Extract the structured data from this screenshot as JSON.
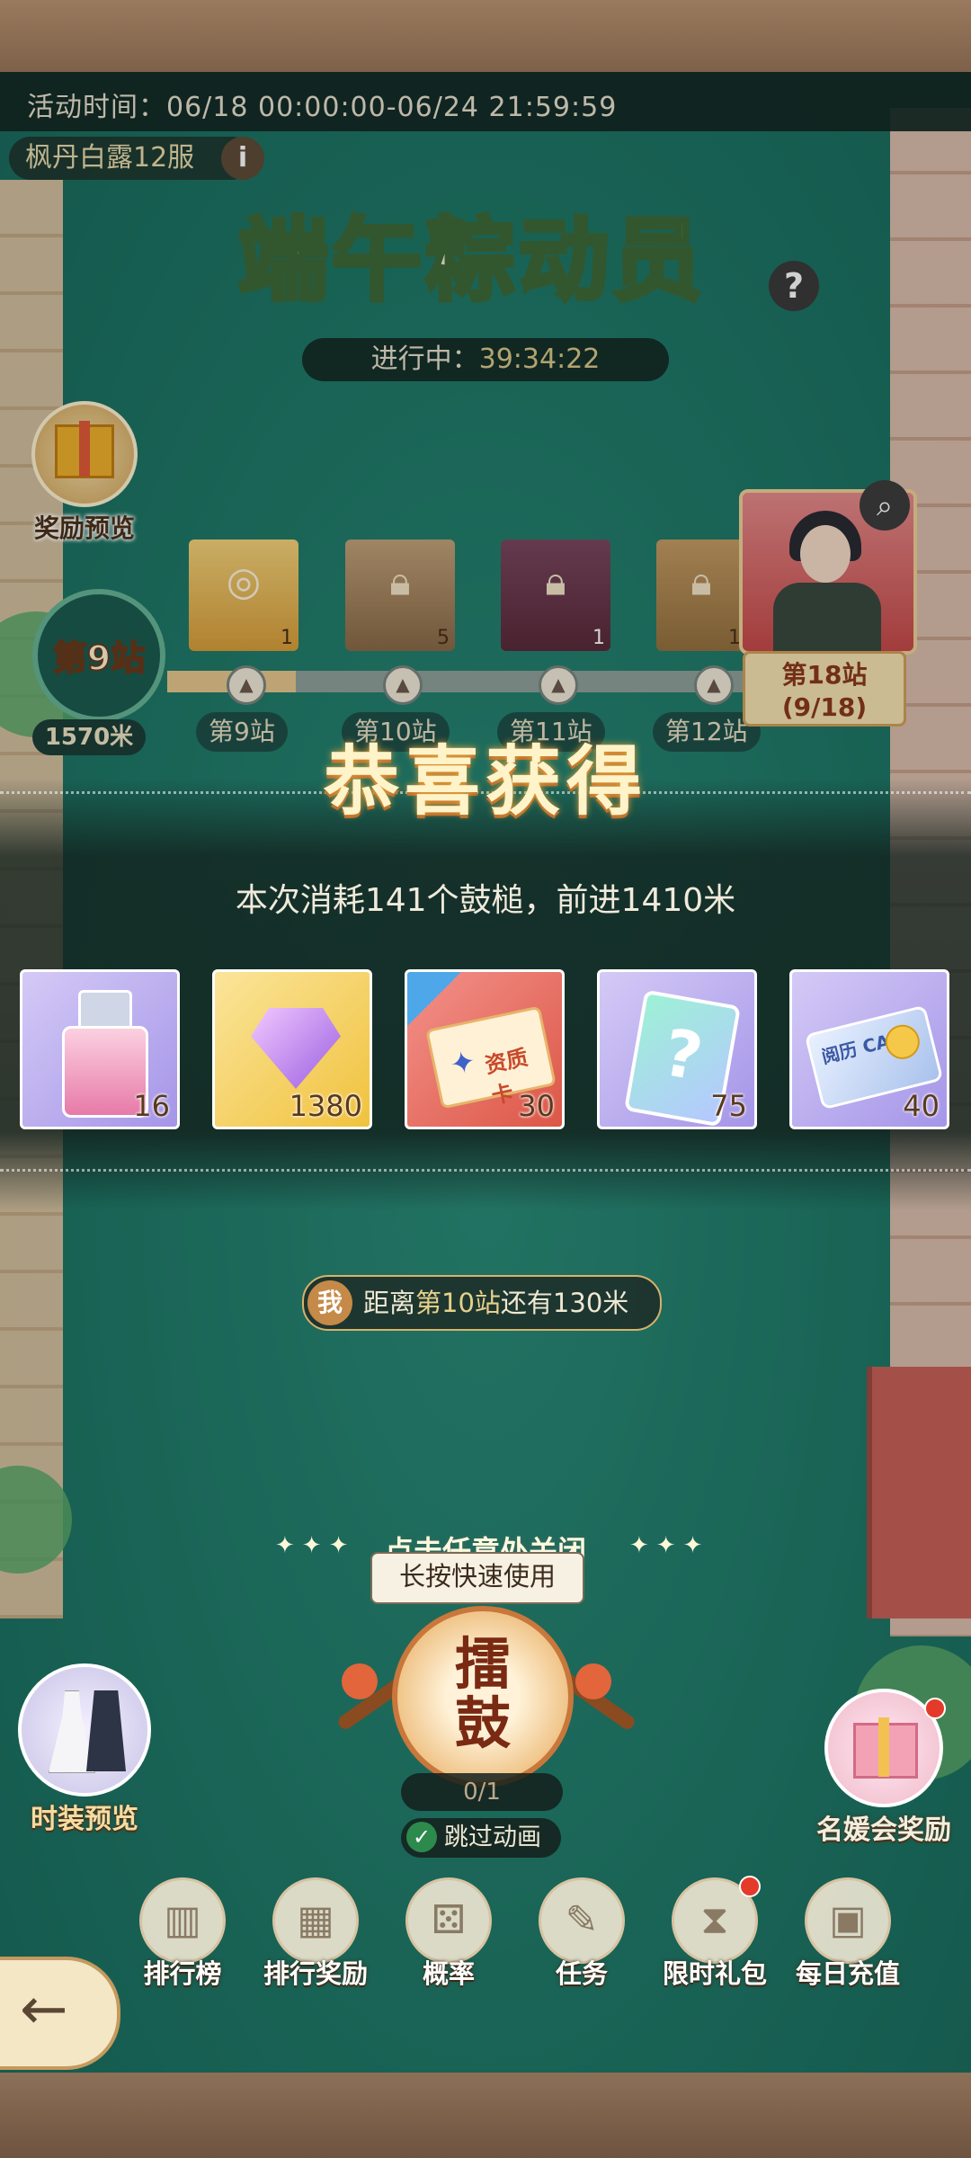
{
  "activity_time": "活动时间：06/18 00:00:00-06/24 21:59:59",
  "server": "枫丹白露12服",
  "title": "端午粽动员",
  "status": {
    "label": "进行中：",
    "value": "39:34:22"
  },
  "left_panel": {
    "reward_preview": "奖励预览",
    "current_station": "第9站",
    "distance": "1570米"
  },
  "track_rewards": [
    {
      "qty": "1"
    },
    {
      "qty": "5"
    },
    {
      "qty": "1"
    },
    {
      "qty": "1"
    }
  ],
  "track_stations": [
    "第9站",
    "第10站",
    "第11站",
    "第12站"
  ],
  "track_progress": 0.22,
  "big_station": {
    "name": "第18站",
    "progress": "(9/18)"
  },
  "popup": {
    "title": "恭喜获得",
    "subtitle": "本次消耗141个鼓槌，前进1410米",
    "items": [
      {
        "name": "perfume-item",
        "qty": "16",
        "color": "#b7a9ee"
      },
      {
        "name": "diamond-item",
        "qty": "1380",
        "color": "#f6d46a"
      },
      {
        "name": "talent-card-item",
        "qty": "30",
        "label": "资质卡",
        "color": "#ec7362"
      },
      {
        "name": "mystery-card-item",
        "qty": "75",
        "color": "#b7a9ee"
      },
      {
        "name": "experience-card-item",
        "qty": "40",
        "label": "阅历 CARD",
        "color": "#b7a9ee"
      }
    ]
  },
  "me_status": {
    "badge": "我",
    "prefix": "距离",
    "station": "第10站",
    "suffix": "还有130米"
  },
  "close_hint": "点击任意处关闭",
  "tooltip": "长按快速使用",
  "drum": {
    "label_top": "擂",
    "label_bottom": "鼓",
    "count": "0/1"
  },
  "skip_animation": "跳过动画",
  "fashion_preview": "时装预览",
  "lady_reward": "名媛会奖励",
  "nav": [
    {
      "label": "排行榜",
      "glyph": "▥"
    },
    {
      "label": "排行奖励",
      "glyph": "▦"
    },
    {
      "label": "概率",
      "glyph": "⚄"
    },
    {
      "label": "任务",
      "glyph": "✎"
    },
    {
      "label": "限时礼包",
      "glyph": "⧗"
    },
    {
      "label": "每日充值",
      "glyph": "▣"
    }
  ],
  "colors": {
    "accent": "#e6d08a",
    "board": "#1f7a69",
    "title_stroke": "#3d6b3a"
  }
}
